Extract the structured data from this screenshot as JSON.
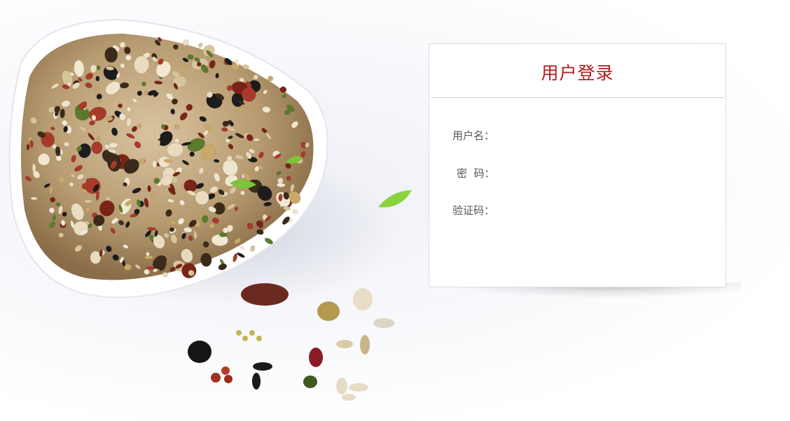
{
  "login": {
    "title": "用户登录",
    "username_label": "用户名：",
    "password_label": "密  码：",
    "captcha_label": "验证码："
  },
  "colors": {
    "title": "#b3191b",
    "panel_border": "#dcdcdc",
    "label": "#555555"
  }
}
